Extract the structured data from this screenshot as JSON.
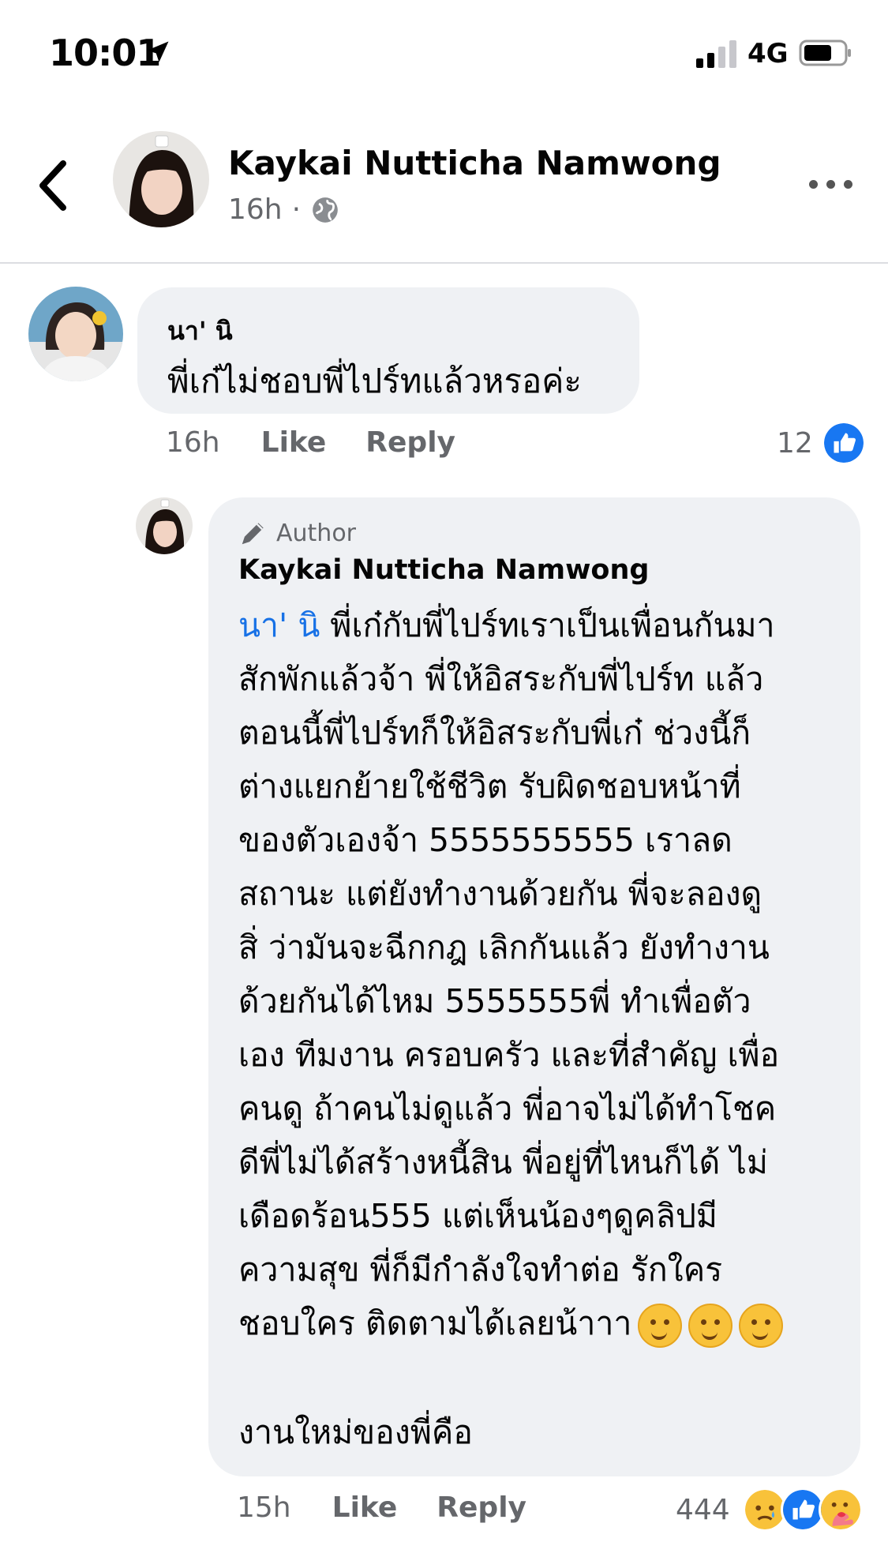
{
  "status_bar": {
    "time": "10:01",
    "network": "4G"
  },
  "header": {
    "name": "Kaykai Nutticha Namwong",
    "time": "16h",
    "separator": "·"
  },
  "comments": [
    {
      "name": "นา' นิ",
      "text": "พี่เก๋ไม่ชอบพี่ไปร์ทแล้วหรอค่ะ",
      "time": "16h",
      "like_label": "Like",
      "reply_label": "Reply",
      "reaction_count": "12"
    },
    {
      "badge": "Author",
      "name": "Kaykai Nutticha Namwong",
      "mention": "นา' นิ",
      "text": " พี่เก๋กับพี่ไปร์ทเราเป็นเพื่อนกันมา\nสักพักแล้วจ้า พี่ให้อิสระกับพี่ไปร์ท แล้ว\nตอนนี้พี่ไปร์ทก็ให้อิสระกับพี่เก๋ ช่วงนี้ก็\nต่างแยกย้ายใช้ชีวิต รับผิดชอบหน้าที่\nของตัวเองจ้า 5555555555 เราลด\nสถานะ แต่ยังทำงานด้วยกัน พี่จะลองดู\nสิ่ ว่ามันจะฉีกกฎ เลิกกันแล้ว ยังทำงาน\nด้วยกันได้ไหม 5555555พี่ ทำเพื่อตัว\nเอง ทีมงาน ครอบครัว และที่สำคัญ เพื่อ\nคนดู ถ้าคนไม่ดูแล้ว พี่อาจไม่ได้ทำโชค\nดีพี่ไม่ได้สร้างหนี้สิน พี่อยู่ที่ไหนก็ได้ ไม่\nเดือดร้อน555 แต่เห็นน้องๆดูคลิปมี\nความสุข พี่ก็มีกำลังใจทำต่อ รักใคร\nชอบใคร ติดตามได้เลยน้าาา",
      "text_2": "งานใหม่ของพี่คือ",
      "time": "15h",
      "like_label": "Like",
      "reply_label": "Reply",
      "reaction_count": "444"
    }
  ],
  "icons": {
    "location": "location-arrow-icon",
    "globe": "globe-icon",
    "like": "like-reaction-icon",
    "sad": "sad-reaction-icon",
    "care": "care-reaction-icon"
  },
  "colors": {
    "accent": "#1771e6",
    "bubble": "#eff1f4",
    "meta": "#65676b"
  }
}
